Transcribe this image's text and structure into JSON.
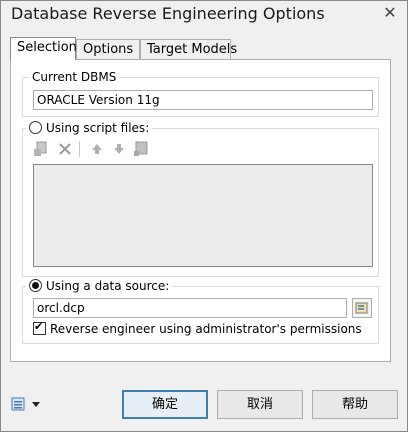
{
  "window": {
    "title": "Database Reverse Engineering Options",
    "close_glyph": "✕"
  },
  "tabs": [
    {
      "label": "Selection",
      "active": true
    },
    {
      "label": "Options",
      "active": false
    },
    {
      "label": "Target Models",
      "active": false
    }
  ],
  "current_dbms": {
    "label": "Current DBMS",
    "value": "ORACLE Version 11g"
  },
  "script_files": {
    "label": "Using script files:",
    "selected": false,
    "toolbar_icons": [
      "add-file-icon",
      "delete-icon",
      "move-up-icon",
      "move-down-icon",
      "properties-icon"
    ]
  },
  "data_source": {
    "label": "Using a data source:",
    "selected": true,
    "value": "orcl.dcp",
    "browse_icon": "browse-data-source-icon",
    "admin_checkbox": {
      "label": "Reverse engineer using administrator's permissions",
      "checked": true
    }
  },
  "footer": {
    "menu_icon": "options-menu-icon",
    "buttons": {
      "ok": "确定",
      "cancel": "取消",
      "help": "帮助"
    }
  }
}
